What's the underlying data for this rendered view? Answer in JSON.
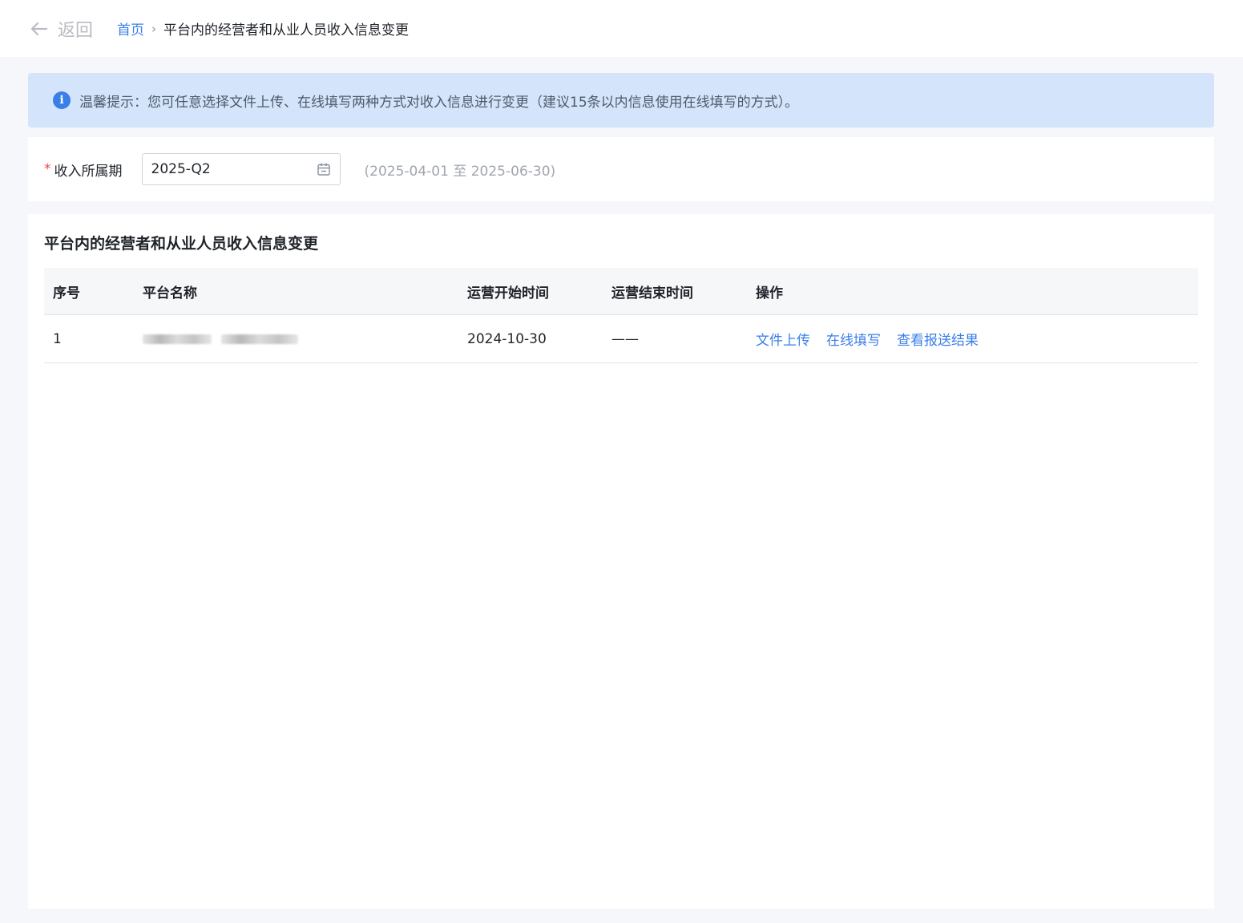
{
  "topbar": {
    "back_label": "返回",
    "breadcrumb": {
      "home": "首页",
      "separator": "›",
      "current": "平台内的经营者和从业人员收入信息变更"
    }
  },
  "notice": {
    "icon": "info-icon",
    "text": "温馨提示：您可任意选择文件上传、在线填写两种方式对收入信息进行变更（建议15条以内信息使用在线填写的方式）。"
  },
  "filter": {
    "required_mark": "*",
    "label": "收入所属期",
    "period_value": "2025-Q2",
    "period_range": "(2025-04-01 至 2025-06-30)"
  },
  "table": {
    "title": "平台内的经营者和从业人员收入信息变更",
    "columns": [
      "序号",
      "平台名称",
      "运营开始时间",
      "运营结束时间",
      "操作"
    ],
    "rows": [
      {
        "index": "1",
        "platform_name": "",
        "start_date": "2024-10-30",
        "end_date": "——",
        "actions": [
          "文件上传",
          "在线填写",
          "查看报送结果"
        ]
      }
    ]
  },
  "colors": {
    "accent": "#3a7ee8",
    "notice_bg": "#d4e5fb",
    "required": "#f53f3f"
  }
}
